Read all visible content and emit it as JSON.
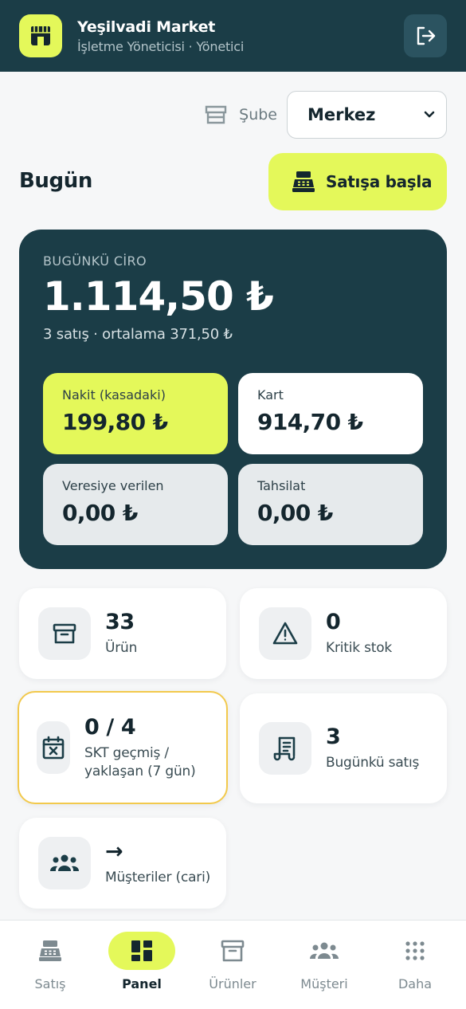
{
  "header": {
    "title": "Yeşilvadi Market",
    "subtitle": "İşletme Yöneticisi · Yönetici",
    "logo_icon": "store-icon",
    "logout_icon": "logout-icon"
  },
  "branch": {
    "label": "Şube",
    "selected": "Merkez",
    "icon": "store-outline-icon"
  },
  "dashboard": {
    "heading": "Bugün",
    "start_sale_label": "Satışa başla"
  },
  "revenue": {
    "label": "BUGÜNKÜ CİRO",
    "amount": "1.114,50 ₺",
    "summary": "3 satış · ortalama 371,50 ₺",
    "tiles": [
      {
        "label": "Nakit (kasadaki)",
        "value": "199,80 ₺"
      },
      {
        "label": "Kart",
        "value": "914,70 ₺"
      },
      {
        "label": "Veresiye verilen",
        "value": "0,00 ₺"
      },
      {
        "label": "Tahsilat",
        "value": "0,00 ₺"
      }
    ]
  },
  "stats": [
    {
      "value": "33",
      "label": "Ürün",
      "icon": "archive-box-icon"
    },
    {
      "value": "0",
      "label": "Kritik stok",
      "icon": "warning-triangle-icon"
    },
    {
      "value": "0 / 4",
      "label_line1": "SKT geçmiş /",
      "label_line2": "yaklaşan (7 gün)",
      "icon": "calendar-x-icon"
    },
    {
      "value": "3",
      "label": "Bugünkü satış",
      "icon": "receipt-icon"
    },
    {
      "value": "→",
      "label": "Müşteriler (cari)",
      "icon": "users-group-icon"
    }
  ],
  "tabs": [
    {
      "label": "Satış",
      "icon": "cash-register-icon",
      "active": false
    },
    {
      "label": "Panel",
      "icon": "dashboard-grid-icon",
      "active": true
    },
    {
      "label": "Ürünler",
      "icon": "archive-box-icon",
      "active": false
    },
    {
      "label": "Müşteri",
      "icon": "users-group-icon",
      "active": false
    },
    {
      "label": "Daha",
      "icon": "dots-grid-icon",
      "active": false
    }
  ],
  "colors": {
    "primary_dark": "#1b3d47",
    "accent_lime": "#e4f85a",
    "warning_border": "#f2c94c",
    "background": "#f6f7f8"
  }
}
